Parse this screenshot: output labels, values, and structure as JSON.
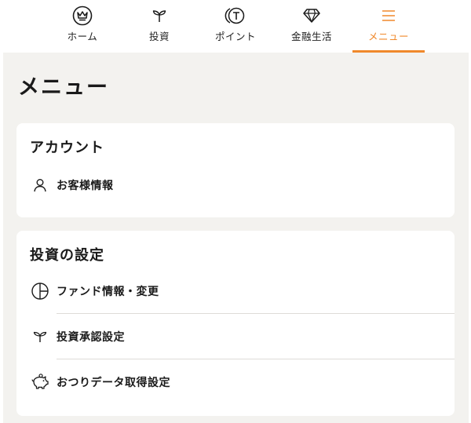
{
  "nav": {
    "items": [
      {
        "label": "ホーム",
        "icon": "home-emblem-icon"
      },
      {
        "label": "投資",
        "icon": "sprout-icon"
      },
      {
        "label": "ポイント",
        "icon": "point-coin-icon"
      },
      {
        "label": "金融生活",
        "icon": "diamond-icon"
      },
      {
        "label": "メニュー",
        "icon": "hamburger-menu-icon",
        "active": true
      }
    ],
    "accent_color": "#f0892b"
  },
  "page": {
    "title": "メニュー"
  },
  "sections": {
    "account": {
      "title": "アカウント",
      "items": [
        {
          "label": "お客様情報",
          "icon": "person-icon"
        }
      ]
    },
    "invest": {
      "title": "投資の設定",
      "items": [
        {
          "label": "ファンド情報・変更",
          "icon": "pie-chart-icon"
        },
        {
          "label": "投資承認設定",
          "icon": "sprout-icon"
        },
        {
          "label": "おつりデータ取得設定",
          "icon": "piggy-bank-icon"
        }
      ]
    }
  }
}
